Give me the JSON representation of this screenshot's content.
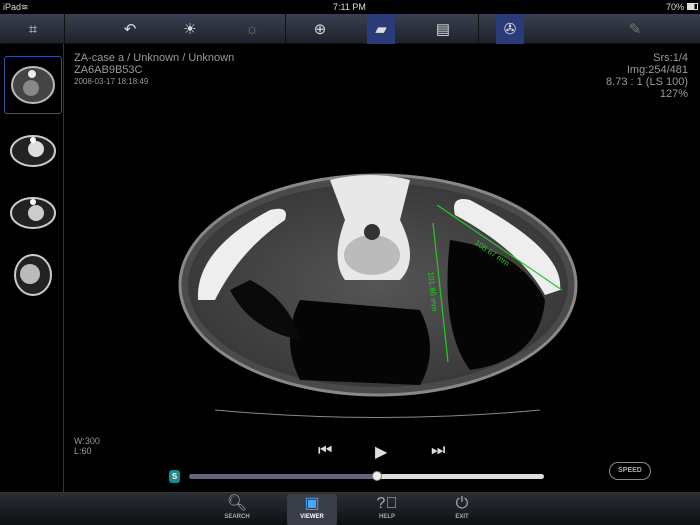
{
  "status": {
    "device": "iPad",
    "time": "7:11 PM",
    "battery": "70%"
  },
  "toolbar": {
    "icons": [
      "fit-screen-icon",
      "undo-icon",
      "brightness-icon",
      "brightness-dim-icon",
      "crosshair-icon",
      "ruler-icon",
      "report-icon",
      "cine-icon",
      "annotate-icon"
    ],
    "active": [
      "ruler-icon",
      "cine-icon"
    ]
  },
  "patient": {
    "name": "ZA-case a / Unknown / Unknown",
    "id": "ZA6AB9B53C",
    "datetime": "2008-03-17 18:18:49"
  },
  "series": {
    "srs": "Srs:1/4",
    "img": "Img:254/481",
    "ratio": "8.73 : 1 (LS 100)",
    "zoom": "127%"
  },
  "window": {
    "w": "W:300",
    "l": "L:60"
  },
  "measurements": [
    "108.67 mm",
    "101.86 mm"
  ],
  "cine": {
    "s_badge": "S",
    "speed": "SPEED",
    "progress": 0.53
  },
  "tabs": [
    {
      "label": "SEARCH"
    },
    {
      "label": "VIEWER"
    },
    {
      "label": "HELP"
    },
    {
      "label": "EXIT"
    }
  ],
  "colors": {
    "measure": "#22cc22",
    "active": "#2b3b7a"
  }
}
